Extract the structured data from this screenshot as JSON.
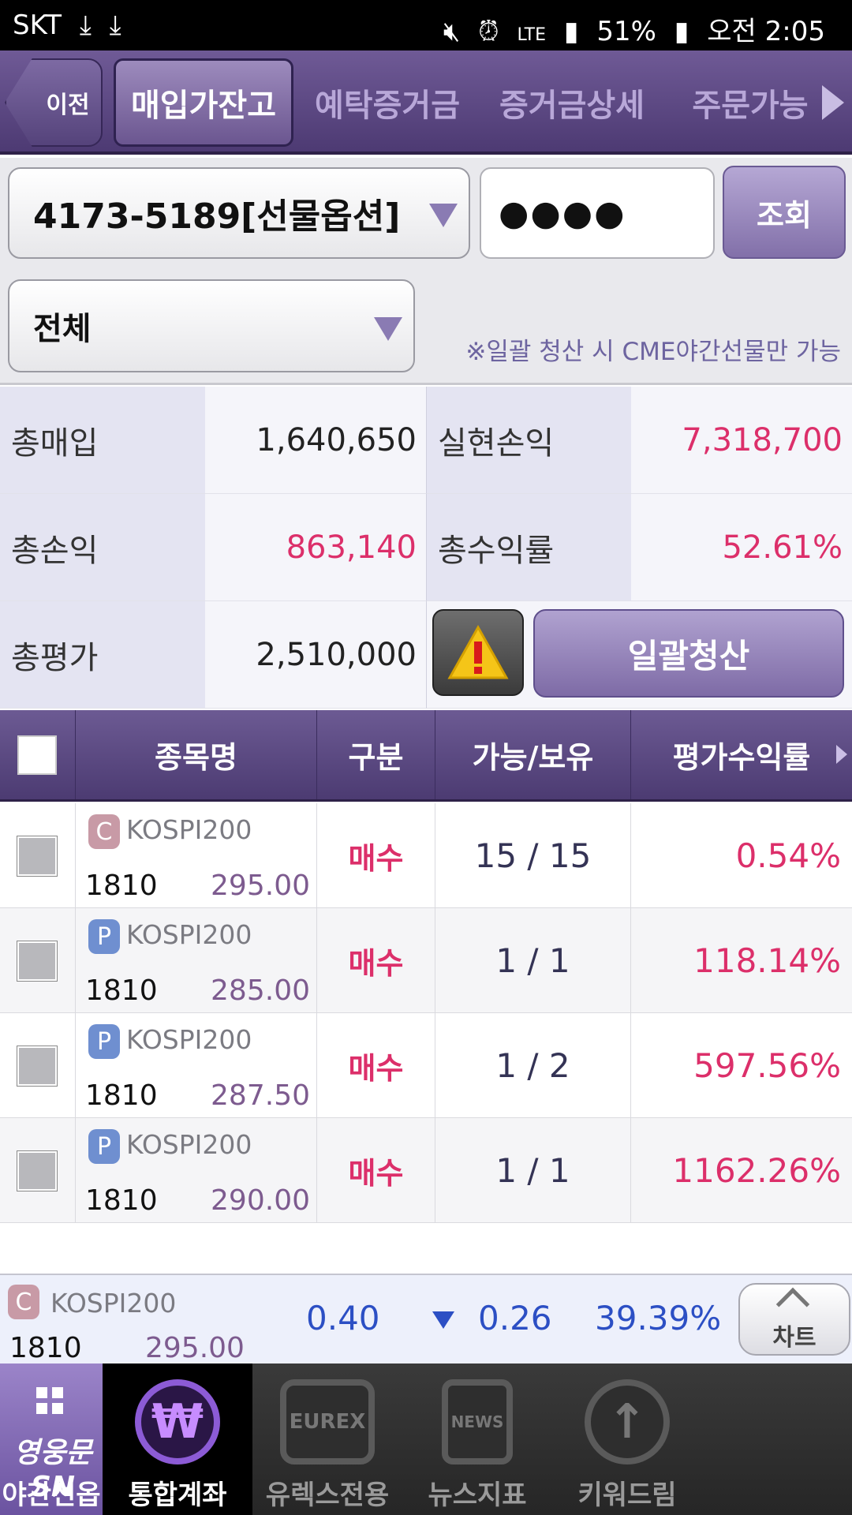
{
  "status_bar": {
    "carrier": "SKT",
    "left_icons": [
      "download-icon",
      "download-icon"
    ],
    "right_icons": [
      "mute-icon",
      "alarm-icon",
      "lte-icon",
      "signal-icon",
      "battery-icon"
    ],
    "battery": "51%",
    "time": "오전 2:05"
  },
  "tabs": {
    "back_label": "이전",
    "items": [
      "매입가잔고",
      "예탁증거금",
      "증거금상세",
      "주문가능"
    ],
    "active_index": 0
  },
  "search": {
    "account": "4173-5189[선물옵션]",
    "password_mask": "●●●●",
    "query_label": "조회",
    "filter": "전체",
    "notice": "※일괄 청산 시 CME야간선물만 가능"
  },
  "summary": {
    "total_buy_label": "총매입",
    "total_buy": "1,640,650",
    "realized_label": "실현손익",
    "realized": "7,318,700",
    "total_pl_label": "총손익",
    "total_pl": "863,140",
    "total_rate_label": "총수익률",
    "total_rate": "52.61%",
    "total_eval_label": "총평가",
    "total_eval": "2,510,000",
    "settle_label": "일괄청산"
  },
  "table": {
    "headers": [
      "종목명",
      "구분",
      "가능/보유",
      "평가수익률"
    ],
    "rows": [
      {
        "badge": "C",
        "name": "KOSPI200",
        "month": "1810",
        "strike": "295.00",
        "type": "매수",
        "qty": "15  / 15",
        "rate": "0.54%"
      },
      {
        "badge": "P",
        "name": "KOSPI200",
        "month": "1810",
        "strike": "285.00",
        "type": "매수",
        "qty": "1  / 1",
        "rate": "118.14%"
      },
      {
        "badge": "P",
        "name": "KOSPI200",
        "month": "1810",
        "strike": "287.50",
        "type": "매수",
        "qty": "1  / 2",
        "rate": "597.56%"
      },
      {
        "badge": "P",
        "name": "KOSPI200",
        "month": "1810",
        "strike": "290.00",
        "type": "매수",
        "qty": "1  / 1",
        "rate": "1162.26%"
      }
    ]
  },
  "quote": {
    "badge": "C",
    "name": "KOSPI200",
    "month": "1810",
    "strike": "295.00",
    "price": "0.40",
    "change": "0.26",
    "rate": "39.39%",
    "chart_label": "차트"
  },
  "bottom_nav": {
    "first_text": "영웅문SN",
    "items": [
      "야간선옵",
      "통합계좌",
      "유렉스전용",
      "뉴스지표",
      "키워드림"
    ],
    "eurex_text": "EUREX",
    "news_text": "NEWS"
  },
  "colors": {
    "accent_purple": "#5b4784",
    "positive_pink": "#dc2f6a",
    "quote_blue": "#2c4fc4"
  }
}
